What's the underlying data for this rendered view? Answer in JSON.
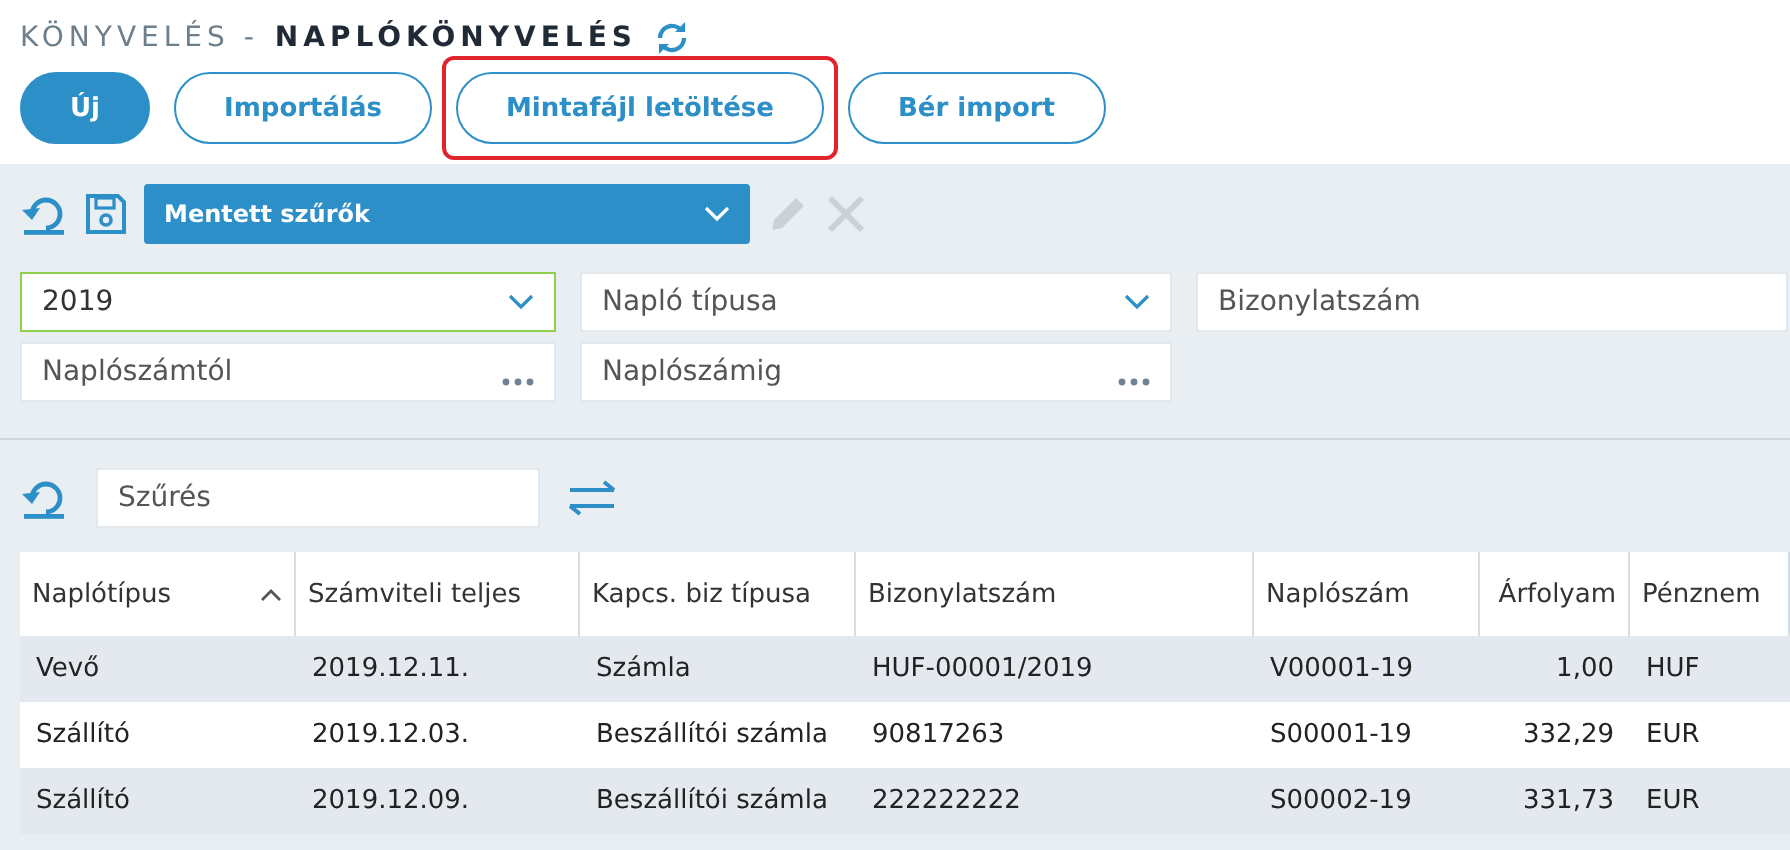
{
  "breadcrumb": {
    "section": "KÖNYVELÉS -",
    "page": "NAPLÓKÖNYVELÉS"
  },
  "actions": [
    {
      "label": "Új",
      "kind": "primary",
      "highlighted": false
    },
    {
      "label": "Importálás",
      "kind": "outline",
      "highlighted": false
    },
    {
      "label": "Mintafájl letöltése",
      "kind": "outline",
      "highlighted": true
    },
    {
      "label": "Bér import",
      "kind": "outline",
      "highlighted": false
    }
  ],
  "saved_filters": {
    "value": "Mentett szűrők"
  },
  "filters": [
    [
      {
        "kind": "select",
        "value": "2019",
        "focused": true
      },
      {
        "kind": "select",
        "placeholder": "Napló típusa",
        "focused": false
      },
      {
        "kind": "text",
        "placeholder": "Bizonylatszám",
        "focused": false
      }
    ],
    [
      {
        "kind": "lookup",
        "placeholder": "Naplószámtól",
        "focused": false
      },
      {
        "kind": "lookup",
        "placeholder": "Naplószámig",
        "focused": false
      }
    ]
  ],
  "search": {
    "placeholder": "Szűrés"
  },
  "table": {
    "columns": [
      {
        "label": "Naplótípus",
        "sorted": true,
        "numeric": false
      },
      {
        "label": "Számviteli teljes",
        "sorted": false,
        "numeric": false
      },
      {
        "label": "Kapcs. biz típusa",
        "sorted": false,
        "numeric": false
      },
      {
        "label": "Bizonylatszám",
        "sorted": false,
        "numeric": false
      },
      {
        "label": "Naplószám",
        "sorted": false,
        "numeric": false
      },
      {
        "label": "Árfolyam",
        "sorted": false,
        "numeric": true
      },
      {
        "label": "Pénznem",
        "sorted": false,
        "numeric": false
      }
    ],
    "rows": [
      [
        "Vevő",
        "2019.12.11.",
        "Számla",
        "HUF-00001/2019",
        "V00001-19",
        "1,00",
        "HUF"
      ],
      [
        "Szállító",
        "2019.12.03.",
        "Beszállítói számla",
        "90817263",
        "S00001-19",
        "332,29",
        "EUR"
      ],
      [
        "Szállító",
        "2019.12.09.",
        "Beszállítói számla",
        "222222222",
        "S00002-19",
        "331,73",
        "EUR"
      ]
    ]
  }
}
